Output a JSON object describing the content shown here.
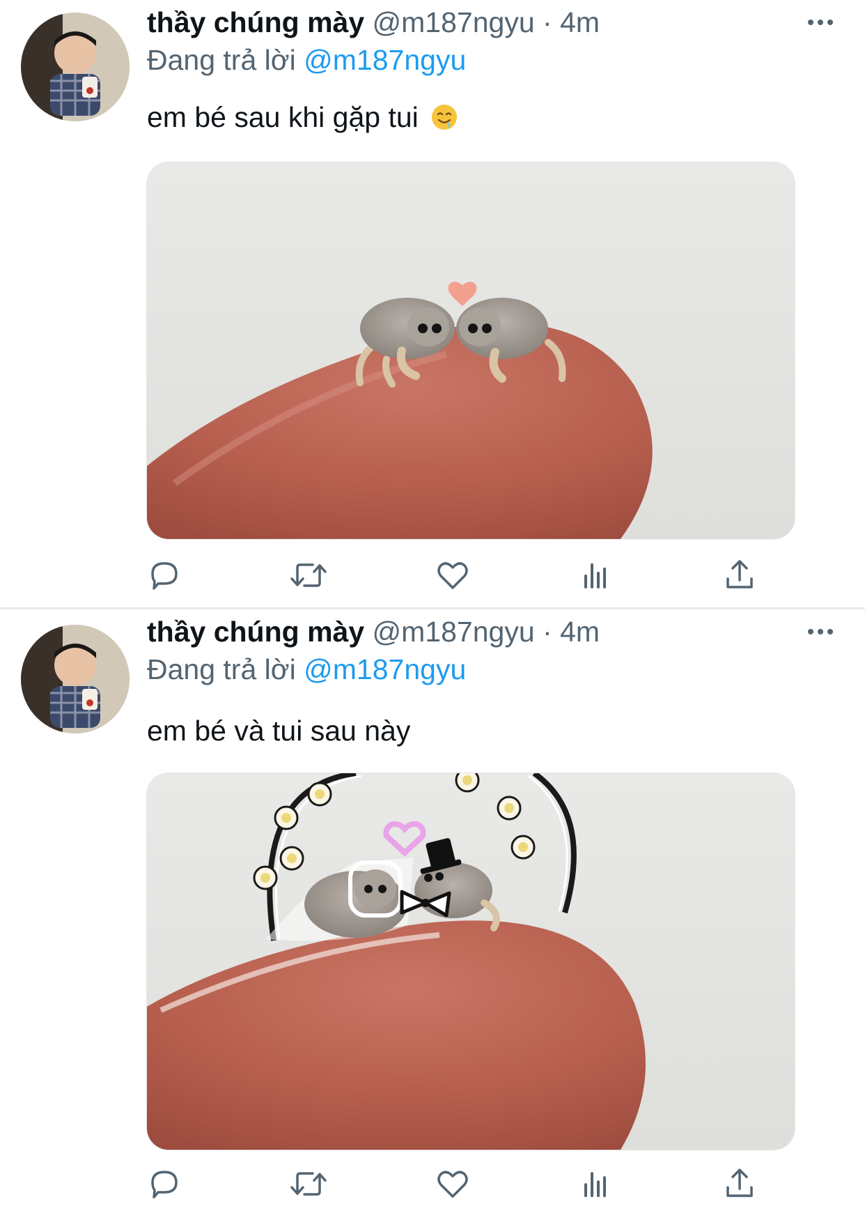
{
  "colors": {
    "text_primary": "#0f1419",
    "text_secondary": "#536471",
    "mention": "#1d9bf0",
    "divider": "#e6ecf0"
  },
  "tweets": [
    {
      "author": {
        "display_name": "thầy chúng mày",
        "handle": "@m187ngyu"
      },
      "separator": "·",
      "time": "4m",
      "reply_prefix": "Đang trả lời",
      "reply_to": "@m187ngyu",
      "text": "em bé sau khi gặp tui",
      "emoji": "drooling-face-icon",
      "actions": [
        "reply-icon",
        "retweet-icon",
        "like-icon",
        "views-icon",
        "share-icon"
      ]
    },
    {
      "author": {
        "display_name": "thầy chúng mày",
        "handle": "@m187ngyu"
      },
      "separator": "·",
      "time": "4m",
      "reply_prefix": "Đang trả lời",
      "reply_to": "@m187ngyu",
      "text": "em bé và tui sau này",
      "actions": [
        "reply-icon",
        "retweet-icon",
        "like-icon",
        "views-icon",
        "share-icon"
      ]
    }
  ]
}
